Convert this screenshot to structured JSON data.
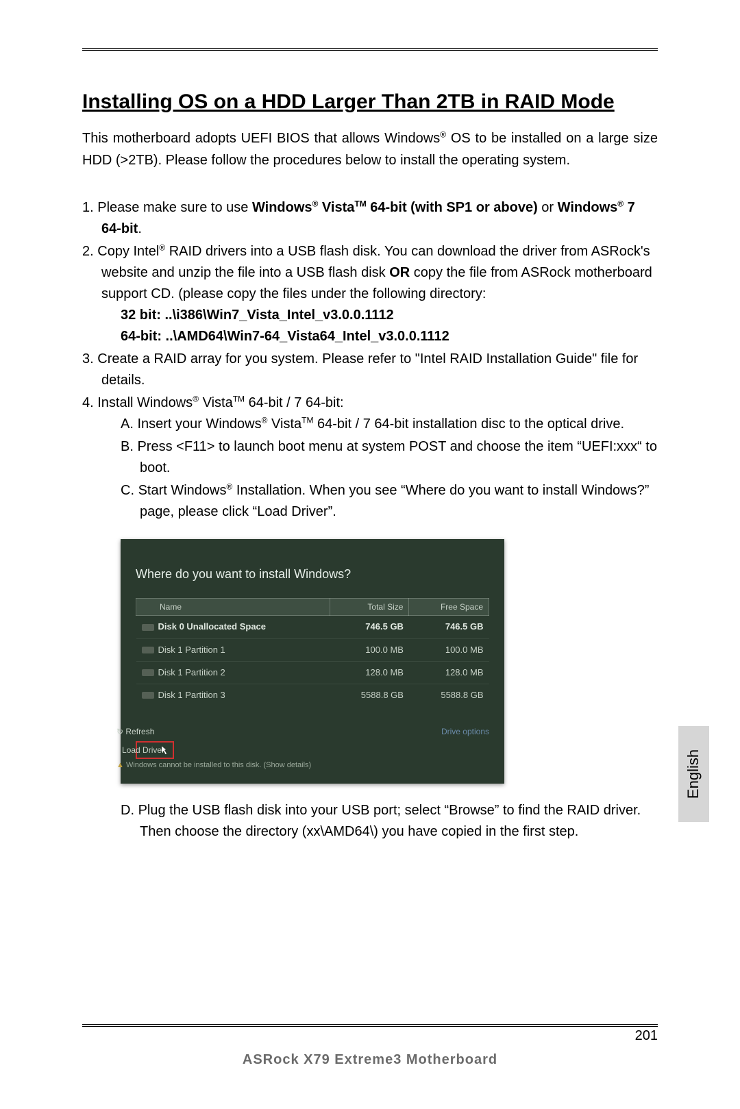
{
  "header": {
    "title": "Installing OS on a HDD Larger Than 2TB in RAID Mode"
  },
  "intro": {
    "pre": "This motherboard adopts UEFI BIOS that allows Windows",
    "sup1": "®",
    "post": " OS to be installed on a large size HDD (>2TB). Please follow the procedures below to install the operating system."
  },
  "steps": {
    "s1": {
      "num": "1. ",
      "t1": "Please make sure to use ",
      "b1a": "Windows",
      "b1sup": "®",
      "b1b": " Vista",
      "b1tm": "TM",
      "b1c": " 64-bit (with SP1 or above)",
      "t2": " or ",
      "b2a": "Windows",
      "b2sup": "®",
      "b2b": " 7 64-bit",
      "t3": "."
    },
    "s2": {
      "num": "2. ",
      "t1": "Copy Intel",
      "sup": "®",
      "t2": " RAID drivers into a USB flash disk. You can download the driver from ASRock's website and unzip the file into a USB flash disk ",
      "or": "OR",
      "t3": " copy the file from ASRock motherboard support CD. (please copy the files under the following directory:",
      "p32": "32 bit: ..\\i386\\Win7_Vista_Intel_v3.0.0.1112",
      "p64": "64-bit: ..\\AMD64\\Win7-64_Vista64_Intel_v3.0.0.1112"
    },
    "s3": {
      "num": "3. ",
      "text": "Create a RAID array for you system. Please refer to \"Intel RAID Installation Guide\" file for details."
    },
    "s4": {
      "num": "4. ",
      "t1": "Install Windows",
      "sup1": "®",
      "t2": " Vista",
      "tm": "TM",
      "t3": " 64-bit / 7 64-bit:",
      "a": {
        "num": "A. ",
        "t1": "Insert your Windows",
        "sup": "®",
        "t2": " Vista",
        "tm": "TM",
        "t3": " 64-bit / 7 64-bit installation disc to the optical drive."
      },
      "b": {
        "num": "B. ",
        "text": "Press <F11> to launch boot menu at system POST and choose the item “UEFI:xxx“ to boot."
      },
      "c": {
        "num": "C. ",
        "t1": "Start Windows",
        "sup": "®",
        "t2": " Installation. When you see “Where do you want to install Windows?” page, please click “Load Driver”."
      },
      "d": {
        "num": "D. ",
        "text": "Plug the USB flash disk into your USB port; select “Browse” to find the RAID driver. Then choose the directory (xx\\AMD64\\) you have copied in the first step."
      }
    }
  },
  "screenshot": {
    "question": "Where do you want to install Windows?",
    "cols": {
      "name": "Name",
      "total": "Total Size",
      "free": "Free Space"
    },
    "rows": [
      {
        "name": "Disk 0 Unallocated Space",
        "total": "746.5 GB",
        "free": "746.5 GB"
      },
      {
        "name": "Disk 1 Partition 1",
        "total": "100.0 MB",
        "free": "100.0 MB"
      },
      {
        "name": "Disk 1 Partition 2",
        "total": "128.0 MB",
        "free": "128.0 MB"
      },
      {
        "name": "Disk 1 Partition 3",
        "total": "5588.8 GB",
        "free": "5588.8 GB"
      }
    ],
    "refresh": "Refresh",
    "load_driver": "Load Driver",
    "drive_options": "Drive options",
    "warning": "Windows cannot be installed to this disk. (Show details)"
  },
  "side_tab": "English",
  "page_number": "201",
  "footer": "ASRock  X79  Extreme3  Motherboard"
}
